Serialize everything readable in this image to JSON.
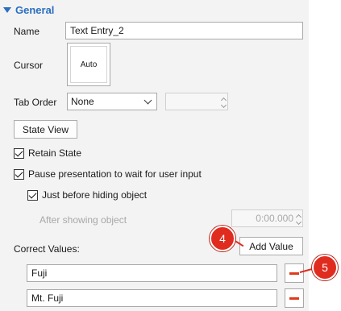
{
  "section": {
    "title": "General"
  },
  "name": {
    "label": "Name",
    "value": "Text Entry_2"
  },
  "cursor": {
    "label": "Cursor",
    "value": "Auto"
  },
  "tab_order": {
    "label": "Tab Order",
    "selected": "None"
  },
  "state_view": {
    "label": "State View"
  },
  "checkboxes": {
    "retain_state": {
      "label": "Retain State",
      "checked": true
    },
    "pause_presentation": {
      "label": "Pause presentation to wait for user input",
      "checked": true
    },
    "just_before_hiding": {
      "label": "Just before hiding object",
      "checked": true
    }
  },
  "after_showing": {
    "label": "After showing object",
    "value": "0:00.000"
  },
  "correct_values": {
    "label": "Correct Values:",
    "add_button": "Add Value",
    "items": [
      "Fuji",
      "Mt. Fuji"
    ]
  },
  "callouts": {
    "add_value": "4",
    "remove_value": "5"
  },
  "colors": {
    "accent": "#2a6fc0",
    "callout": "#e02c1f",
    "minus": "#e03a1e"
  }
}
